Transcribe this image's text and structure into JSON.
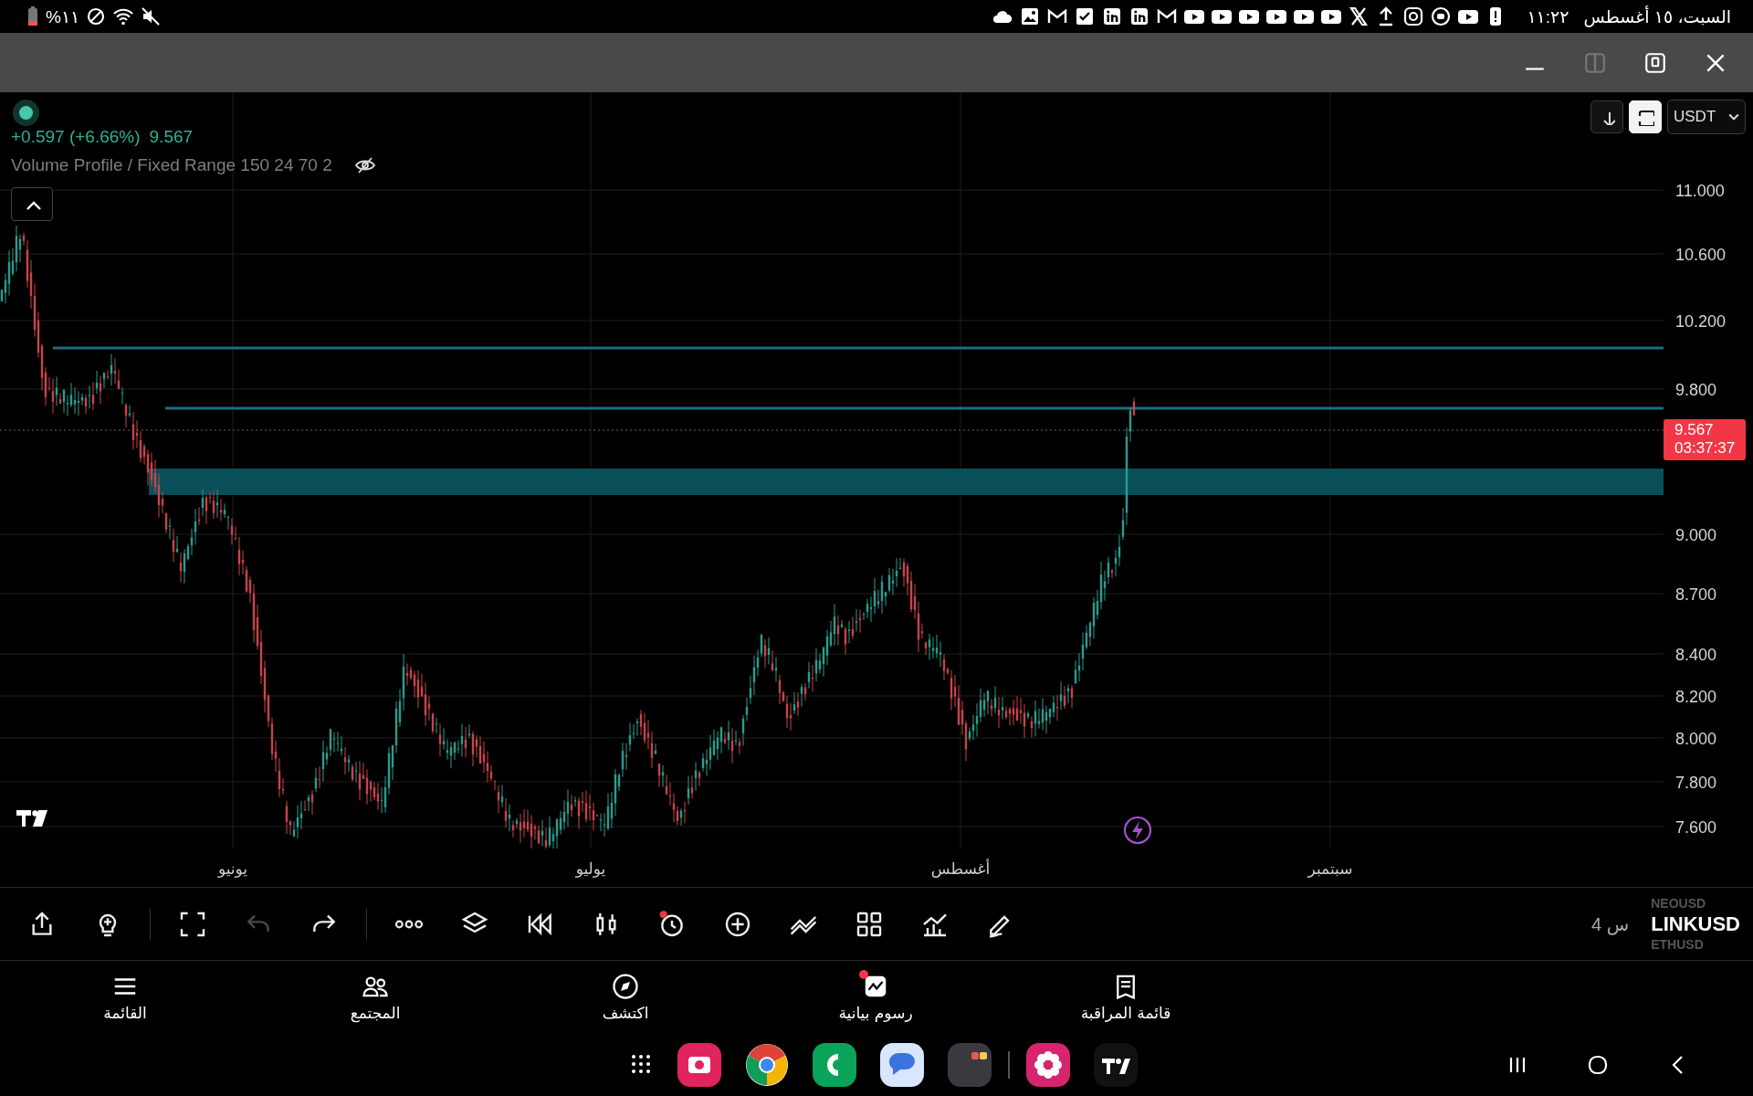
{
  "status_bar": {
    "battery": "%١١",
    "time": "١١:٢٢",
    "date": "السبت، ١٥ أغسطس"
  },
  "window_controls": [
    {
      "kind": "minimize",
      "disabled": false
    },
    {
      "kind": "split",
      "disabled": true
    },
    {
      "kind": "popup",
      "disabled": false
    },
    {
      "kind": "close",
      "disabled": false
    }
  ],
  "chart": {
    "change": "+0.597 (+6.66%)",
    "last": "9.567",
    "indicator": "Volume Profile / Fixed Range 150 24 70 2",
    "currency": "USDT",
    "price_ticks": [
      "11.000",
      "10.600",
      "10.200",
      "9.800",
      "9.000",
      "8.700",
      "8.400",
      "8.200",
      "8.000",
      "7.800",
      "7.600"
    ],
    "month_labels": [
      "سبتمبر",
      "أغسطس",
      "يوليو",
      "يونيو"
    ],
    "price_badge": {
      "price": "9.567",
      "countdown": "03:37:37"
    }
  },
  "toolbar": {
    "tools": [
      {
        "kind": "share",
        "disabled": false
      },
      {
        "kind": "bulb",
        "disabled": false
      },
      {
        "kind": "fullscreen",
        "disabled": false
      },
      {
        "kind": "undo",
        "disabled": true
      },
      {
        "kind": "redo",
        "disabled": false
      },
      {
        "kind": "more",
        "disabled": false
      },
      {
        "kind": "layers",
        "disabled": false
      },
      {
        "kind": "replay",
        "disabled": false
      },
      {
        "kind": "candles",
        "disabled": false
      },
      {
        "kind": "alarm",
        "disabled": false
      },
      {
        "kind": "add",
        "disabled": false
      },
      {
        "kind": "trend",
        "disabled": false
      },
      {
        "kind": "grid",
        "disabled": false
      },
      {
        "kind": "indicators",
        "disabled": false
      },
      {
        "kind": "pencil",
        "disabled": false
      }
    ],
    "interval": "4 س",
    "symbols": [
      {
        "label": "NEOUSD",
        "selected": false
      },
      {
        "label": "LINKUSD",
        "selected": true
      },
      {
        "label": "ETHUSD",
        "selected": false
      }
    ]
  },
  "bottom_nav": [
    {
      "kind": "watchlist",
      "label": "قائمة المراقبة",
      "notification": false
    },
    {
      "kind": "charts",
      "label": "رسوم بيانية",
      "notification": true
    },
    {
      "kind": "explore",
      "label": "اكتشف",
      "notification": false
    },
    {
      "kind": "community",
      "label": "المجتمع",
      "notification": false
    },
    {
      "kind": "menu",
      "label": "القائمة",
      "notification": false
    }
  ]
}
